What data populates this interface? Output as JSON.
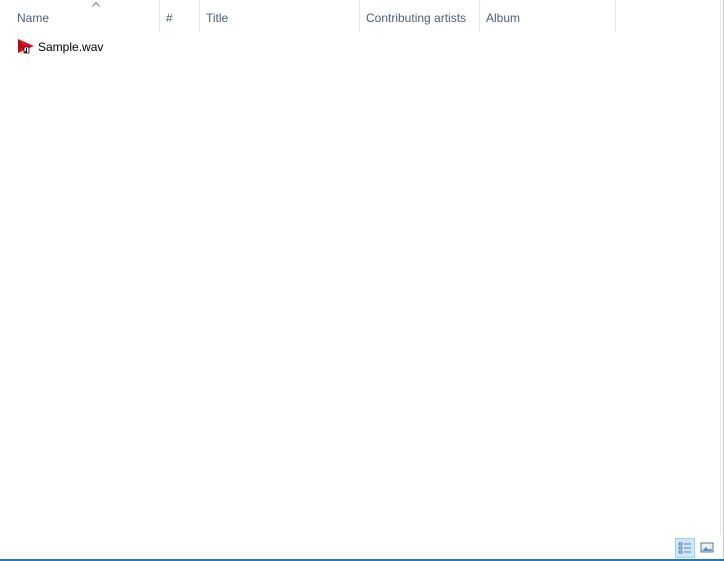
{
  "columns": [
    {
      "label": "Name",
      "sorted": "ascending"
    },
    {
      "label": "#"
    },
    {
      "label": "Title"
    },
    {
      "label": "Contributing artists"
    },
    {
      "label": "Album"
    }
  ],
  "files": [
    {
      "name": "Sample.wav",
      "icon": "wav-audio-file-icon"
    }
  ],
  "view_buttons": {
    "active": "details",
    "details_icon": "details-view-icon",
    "tiles_icon": "large-icons-view-icon"
  },
  "colors": {
    "header_text": "#4c607a",
    "header_divider": "#e3e8ef",
    "selected_view_bg": "#cce8ff",
    "selected_view_border": "#99d1ff",
    "accent_border": "#1979ca",
    "file_icon_red": "#e81123"
  }
}
